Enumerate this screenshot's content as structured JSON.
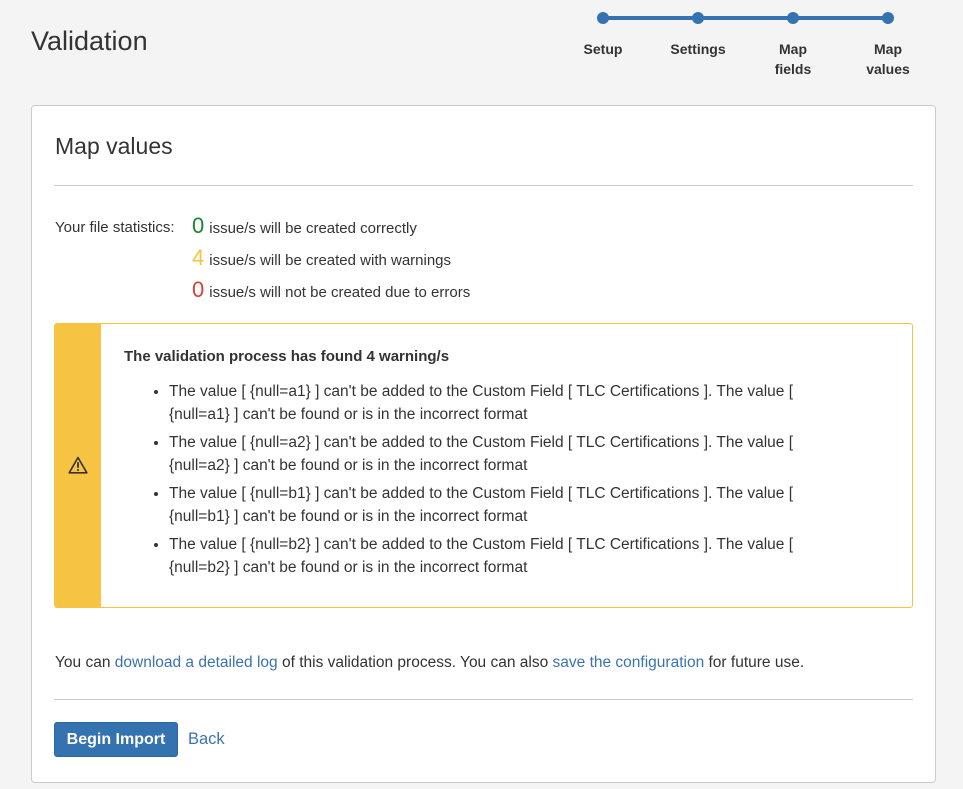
{
  "page": {
    "title": "Validation"
  },
  "steps": [
    {
      "label": "Setup"
    },
    {
      "label": "Settings"
    },
    {
      "label": "Map fields"
    },
    {
      "label": "Map values"
    }
  ],
  "card": {
    "heading": "Map values"
  },
  "stats": {
    "label": "Your file statistics:",
    "rows": [
      {
        "count": "0",
        "text": "issue/s will be created correctly",
        "color": "#14892c"
      },
      {
        "count": "4",
        "text": "issue/s will be created with warnings",
        "color": "#f6c342"
      },
      {
        "count": "0",
        "text": "issue/s will not be created due to errors",
        "color": "#d04437"
      }
    ]
  },
  "warning": {
    "icon": "warning-icon",
    "color": "#f6c342",
    "title": "The validation process has found 4 warning/s",
    "items": [
      {
        "text": "The value [ {null=a1} ] can't be added to the Custom Field [ TLC Certifications ]. The value [ {null=a1} ] can't be found or is in the incorrect format"
      },
      {
        "text": "The value [ {null=a2} ] can't be added to the Custom Field [ TLC Certifications ]. The value [ {null=a2} ] can't be found or is in the incorrect format"
      },
      {
        "text": "The value [ {null=b1} ] can't be added to the Custom Field [ TLC Certifications ]. The value [ {null=b1} ] can't be found or is in the incorrect format"
      },
      {
        "text": "The value [ {null=b2} ] can't be added to the Custom Field [ TLC Certifications ]. The value [ {null=b2} ] can't be found or is in the incorrect format"
      }
    ]
  },
  "footer": {
    "prefix": "You can ",
    "download_link": "download a detailed log",
    "middle": " of this validation process. You can also ",
    "save_link": "save the configuration",
    "suffix": " for future use."
  },
  "actions": {
    "begin_import": "Begin Import",
    "back": "Back"
  },
  "colors": {
    "accent": "#3572b0",
    "link": "#3b73af"
  }
}
